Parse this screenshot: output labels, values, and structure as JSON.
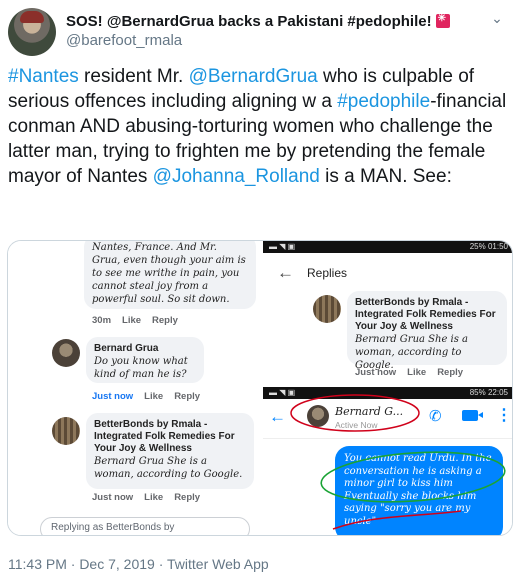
{
  "tweet": {
    "display_name": "SOS! @BernardGrua backs a Pakistani #pedophile!",
    "handle": "@barefoot_rmala",
    "text": {
      "p1": "#Nantes",
      "p2": " resident Mr. ",
      "p3": "@BernardGrua",
      "p4": " who is culpable of serious offences including aligning w a ",
      "p5": "#pedophile",
      "p6": "-financial conman AND abusing-torturing women who challenge the latter man, trying to frighten me by pretending the female mayor of Nantes ",
      "p7": "@Johanna_Rolland",
      "p8": " is a MAN. See:"
    },
    "timestamp": "11:43 PM · Dec 7, 2019 · Twitter Web App",
    "link_color": "#1b95e0"
  },
  "left_screenshot": {
    "top_comment_text": "Nantes, France. And Mr. Grua, even though your aim is to see me writhe in pain, you cannot steal joy from a powerful soul. So sit down.",
    "top_meta": {
      "time": "30m",
      "like": "Like",
      "reply": "Reply"
    },
    "comment1": {
      "name": "Bernard Grua",
      "text": "Do you know what kind of man he is?",
      "meta": {
        "time": "Just now",
        "like": "Like",
        "reply": "Reply"
      }
    },
    "comment2": {
      "name": "BetterBonds by Rmala - Integrated Folk Remedies For Your Joy & Wellness",
      "text": "Bernard Grua She is a woman, according to Google.",
      "meta": {
        "time": "Just now",
        "like": "Like",
        "reply": "Reply"
      }
    },
    "reply_placeholder": "Replying as BetterBonds by"
  },
  "right_screenshot": {
    "status1": {
      "left": "▬ ◥ ▣",
      "right": "25% 01:50"
    },
    "replies_title": "Replies",
    "reply": {
      "name": "BetterBonds by Rmala - Integrated Folk Remedies For Your Joy & Wellness",
      "text": "Bernard Grua She is a woman, according to Google.",
      "meta": {
        "time": "Just now",
        "like": "Like",
        "reply": "Reply"
      }
    },
    "status2": {
      "left": "▬ ◥ ▣",
      "right": "85% 22:05"
    },
    "chat": {
      "name": "Bernard G...",
      "sub": "Active Now"
    },
    "message": "You cannot read Urdu. In the conversation he is asking a minor girl to kiss him Eventually she blocks him saying \"sorry you are my uncle\""
  }
}
